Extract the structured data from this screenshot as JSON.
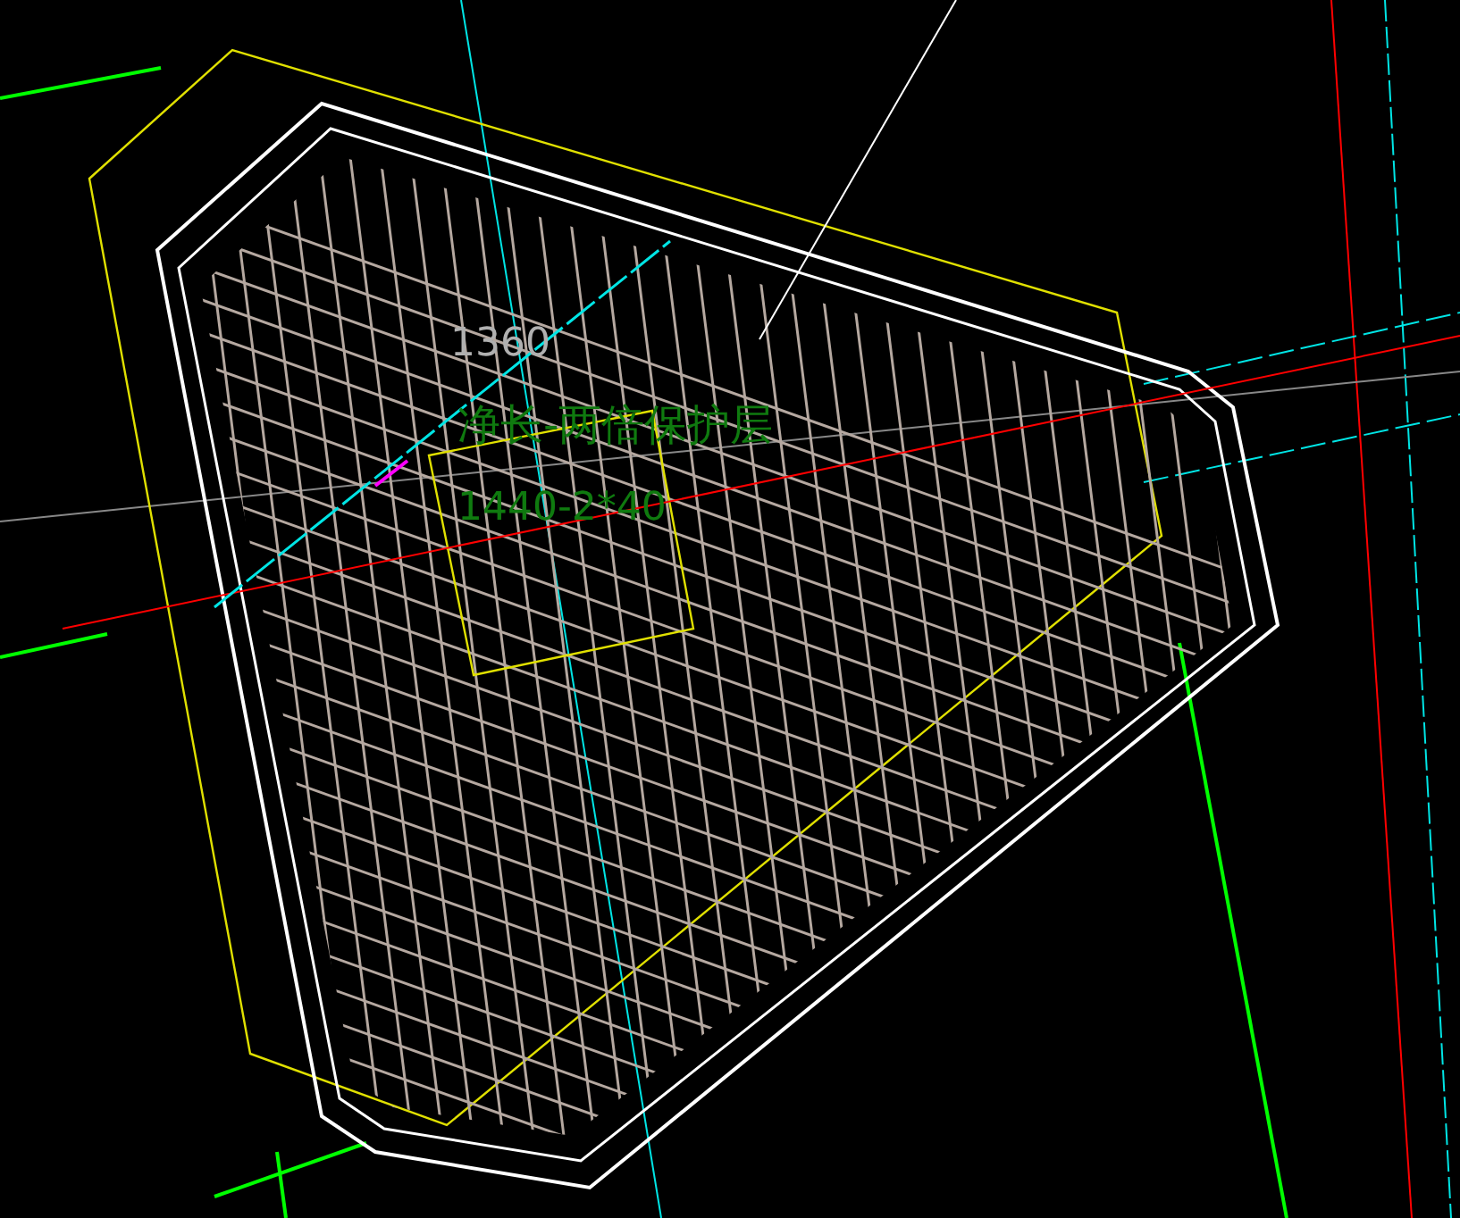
{
  "viewport": {
    "labels": [
      {
        "kind": "dimension",
        "text": "1360"
      },
      {
        "kind": "note",
        "text": "净长-两倍保护层"
      },
      {
        "kind": "note",
        "text": "1440-2*40"
      }
    ]
  }
}
